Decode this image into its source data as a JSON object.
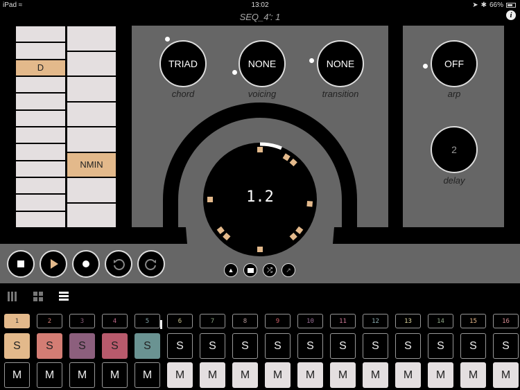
{
  "status_bar": {
    "device": "iPad",
    "time": "13:02",
    "battery": "66%"
  },
  "title": "SEQ_4': 1",
  "info_icon": "info-icon",
  "root_column": {
    "cells": [
      "",
      "",
      "D",
      "",
      "",
      "",
      "",
      "",
      "",
      "",
      "",
      ""
    ],
    "selected_index": 2
  },
  "chord_type_column": {
    "cells": [
      "",
      "",
      "",
      "",
      "",
      "NMIN",
      "",
      ""
    ],
    "selected_index": 5
  },
  "knobs": {
    "chord": {
      "value": "TRIAD",
      "label": "chord"
    },
    "voicing": {
      "value": "NONE",
      "label": "voicing"
    },
    "transition": {
      "value": "NONE",
      "label": "transition"
    },
    "arp": {
      "value": "OFF",
      "label": "arp"
    },
    "delay": {
      "value": "2",
      "label": "delay"
    }
  },
  "position_display": "1.2",
  "accent_color": "#e3b98b",
  "transport": {
    "buttons": [
      "stop-icon",
      "play-icon",
      "record-icon",
      "undo-icon",
      "redo-icon"
    ]
  },
  "small_buttons": [
    "clear-icon",
    "folder-icon",
    "shuffle-icon",
    "share-icon"
  ],
  "view_modes": [
    "columns-view-icon",
    "grid-view-icon",
    "list-view-icon"
  ],
  "active_view": 2,
  "tracks": [
    {
      "num": "1",
      "color": "#e3b98b",
      "solo": "S",
      "mute": "M",
      "solo_on": true,
      "mute_on": false,
      "num_color": "#333"
    },
    {
      "num": "2",
      "color": "#d37d74",
      "solo": "S",
      "mute": "M",
      "solo_on": true,
      "mute_on": false,
      "num_color": "#d37d74"
    },
    {
      "num": "3",
      "color": "#8c5f7d",
      "solo": "S",
      "mute": "M",
      "solo_on": true,
      "mute_on": false,
      "num_color": "#8c5f7d"
    },
    {
      "num": "4",
      "color": "#b85a6c",
      "solo": "S",
      "mute": "M",
      "solo_on": true,
      "mute_on": false,
      "num_color": "#c0688a"
    },
    {
      "num": "5",
      "color": "#6a9392",
      "solo": "S",
      "mute": "M",
      "solo_on": true,
      "mute_on": false,
      "num_color": "#7f9fa3"
    },
    {
      "num": "6",
      "color": "#c9c38f",
      "solo": "S",
      "mute": "M",
      "solo_on": false,
      "mute_on": true,
      "num_color": "#c9c38f"
    },
    {
      "num": "7",
      "color": "#8aa482",
      "solo": "S",
      "mute": "M",
      "solo_on": false,
      "mute_on": true,
      "num_color": "#8aa482"
    },
    {
      "num": "8",
      "color": "#b79a9a",
      "solo": "S",
      "mute": "M",
      "solo_on": false,
      "mute_on": true,
      "num_color": "#b79a9a"
    },
    {
      "num": "9",
      "color": "#d1626a",
      "solo": "S",
      "mute": "M",
      "solo_on": false,
      "mute_on": true,
      "num_color": "#d1626a"
    },
    {
      "num": "10",
      "color": "#9b6f97",
      "solo": "S",
      "mute": "M",
      "solo_on": false,
      "mute_on": true,
      "num_color": "#9b6f97"
    },
    {
      "num": "11",
      "color": "#d17a98",
      "solo": "S",
      "mute": "M",
      "solo_on": false,
      "mute_on": true,
      "num_color": "#d17a98"
    },
    {
      "num": "12",
      "color": "#8fb1b5",
      "solo": "S",
      "mute": "M",
      "solo_on": false,
      "mute_on": true,
      "num_color": "#8fb1b5"
    },
    {
      "num": "13",
      "color": "#e0d8a0",
      "solo": "S",
      "mute": "M",
      "solo_on": false,
      "mute_on": true,
      "num_color": "#e0d8a0"
    },
    {
      "num": "14",
      "color": "#8fa887",
      "solo": "S",
      "mute": "M",
      "solo_on": false,
      "mute_on": true,
      "num_color": "#8fa887"
    },
    {
      "num": "15",
      "color": "#e8b98a",
      "solo": "S",
      "mute": "M",
      "solo_on": false,
      "mute_on": true,
      "num_color": "#e8b98a"
    },
    {
      "num": "16",
      "color": "#d98e94",
      "solo": "S",
      "mute": "M",
      "solo_on": false,
      "mute_on": true,
      "num_color": "#d98e94"
    }
  ],
  "pad_colors": {
    "mute_on": "#e4dfe0",
    "off": "#000"
  }
}
